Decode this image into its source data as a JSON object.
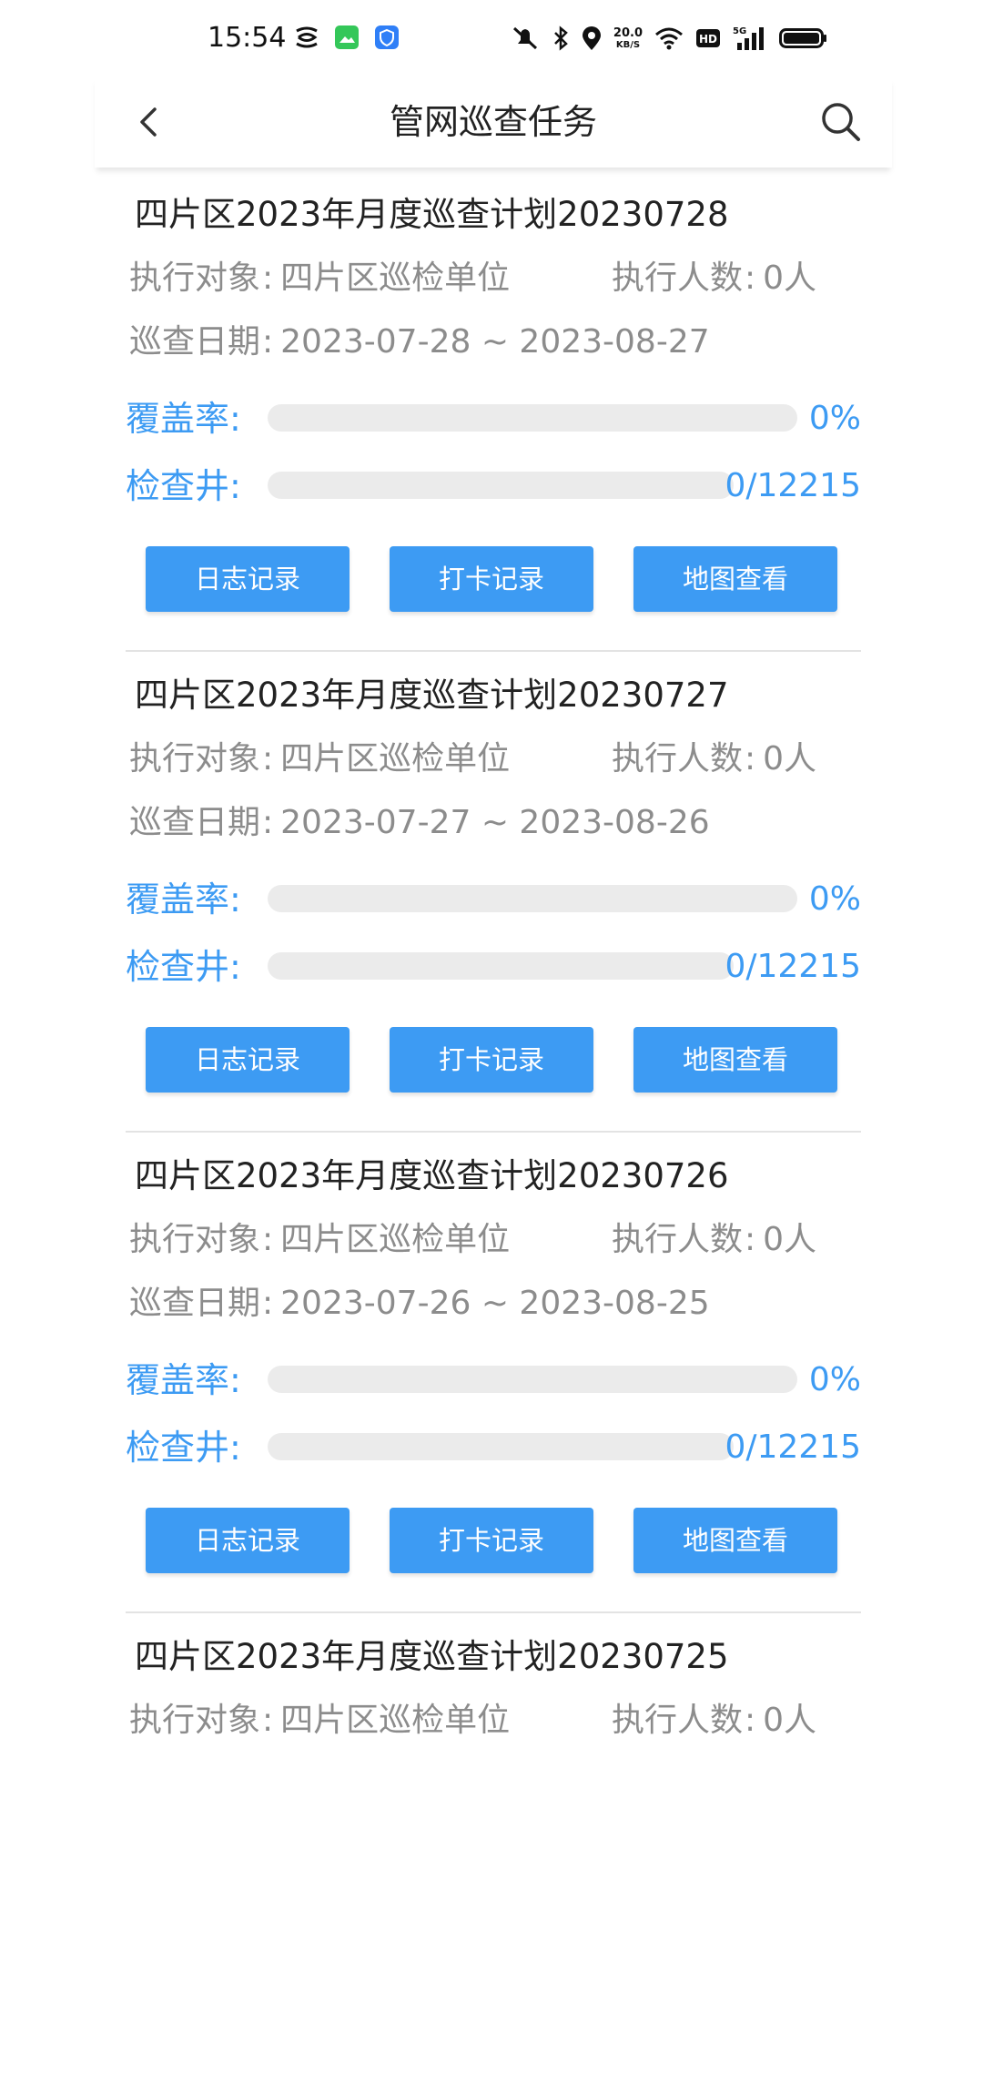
{
  "status_bar": {
    "time": "15:54",
    "net_speed_value": "20.0",
    "net_speed_unit": "KB/S",
    "icons": [
      "nfc-icon",
      "gallery-app-icon",
      "shield-app-icon",
      "mute-icon",
      "bluetooth-icon",
      "location-icon",
      "wifi-icon",
      "hd-icon",
      "signal-5g-icon",
      "battery-icon"
    ]
  },
  "header": {
    "title": "管网巡查任务",
    "back_icon": "back-arrow-icon",
    "search_icon": "search-icon"
  },
  "colors": {
    "accent": "#3d9bf3",
    "muted_text": "#8c8c8c",
    "track": "#ebebeb"
  },
  "labels": {
    "target": "执行对象",
    "people": "执行人数",
    "date": "巡查日期",
    "coverage": "覆盖率:",
    "wells": "检查井:",
    "colon": ":",
    "buttons": [
      "日志记录",
      "打卡记录",
      "地图查看"
    ]
  },
  "tasks": [
    {
      "title": "四片区2023年月度巡查计划20230728",
      "target": "四片区巡检单位",
      "people": "0人",
      "date_range": "2023-07-28 ~ 2023-08-27",
      "coverage_text": "0%",
      "coverage_fraction": 0,
      "wells_text": "0/12215",
      "wells_fraction": 0
    },
    {
      "title": "四片区2023年月度巡查计划20230727",
      "target": "四片区巡检单位",
      "people": "0人",
      "date_range": "2023-07-27 ~ 2023-08-26",
      "coverage_text": "0%",
      "coverage_fraction": 0,
      "wells_text": "0/12215",
      "wells_fraction": 0
    },
    {
      "title": "四片区2023年月度巡查计划20230726",
      "target": "四片区巡检单位",
      "people": "0人",
      "date_range": "2023-07-26 ~ 2023-08-25",
      "coverage_text": "0%",
      "coverage_fraction": 0,
      "wells_text": "0/12215",
      "wells_fraction": 0
    },
    {
      "title": "四片区2023年月度巡查计划20230725",
      "target": "四片区巡检单位",
      "people": "0人"
    }
  ]
}
